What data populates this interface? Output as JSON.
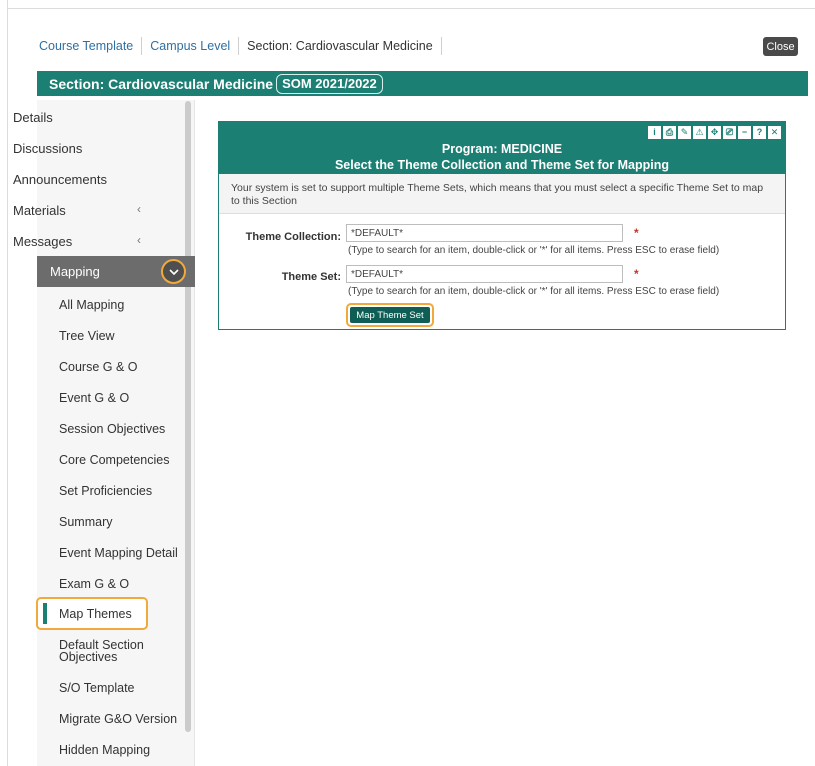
{
  "breadcrumb": [
    "Course Template",
    "Campus Level",
    "Section: Cardiovascular Medicine"
  ],
  "close_label": "Close",
  "section": {
    "title": "Section: Cardiovascular Medicine",
    "term": "SOM 2021/2022"
  },
  "nav": {
    "items": [
      {
        "label": "Details"
      },
      {
        "label": "Discussions"
      },
      {
        "label": "Announcements"
      },
      {
        "label": "Materials"
      },
      {
        "label": "Messages"
      }
    ],
    "active": "Mapping",
    "sub_items": [
      {
        "label": "All Mapping"
      },
      {
        "label": "Tree View"
      },
      {
        "label": "Course G & O"
      },
      {
        "label": "Event G & O"
      },
      {
        "label": "Session Objectives"
      },
      {
        "label": "Core Competencies"
      },
      {
        "label": "Set Proficiencies"
      },
      {
        "label": "Summary"
      },
      {
        "label": "Event Mapping Detail"
      },
      {
        "label": "Exam G & O"
      },
      {
        "label": "Map Themes"
      },
      {
        "label": "Default Section Objectives"
      },
      {
        "label": "S/O Template"
      },
      {
        "label": "Migrate G&O Version"
      },
      {
        "label": "Hidden Mapping"
      }
    ]
  },
  "panel": {
    "title_line1": "Program: MEDICINE",
    "title_line2": "Select the Theme Collection and Theme Set for Mapping",
    "notice": "Your system is set to support multiple Theme Sets, which means that you must select a specific Theme Set to map to this Section",
    "collection_label": "Theme Collection:",
    "collection_value": "*DEFAULT*",
    "set_label": "Theme Set:",
    "set_value": "*DEFAULT*",
    "required_mark": "*",
    "hint": "(Type to search for an item, double-click or '*' for all items. Press ESC to erase field)",
    "button": "Map Theme Set",
    "icons": [
      {
        "glyph": "i",
        "name": "info-icon"
      },
      {
        "glyph": "⎙",
        "name": "lock-icon"
      },
      {
        "glyph": "✎",
        "name": "edit-icon"
      },
      {
        "glyph": "⚠",
        "name": "alert-icon"
      },
      {
        "glyph": "✥",
        "name": "move-icon"
      },
      {
        "glyph": "⎚",
        "name": "print-icon"
      },
      {
        "glyph": "−",
        "name": "minimize-icon"
      },
      {
        "glyph": "?",
        "name": "help-icon"
      },
      {
        "glyph": "✕",
        "name": "close-icon"
      }
    ]
  },
  "colors": {
    "brand": "#1b7f74",
    "highlight": "#f2a93b",
    "active_nav": "#6c6c6c"
  }
}
